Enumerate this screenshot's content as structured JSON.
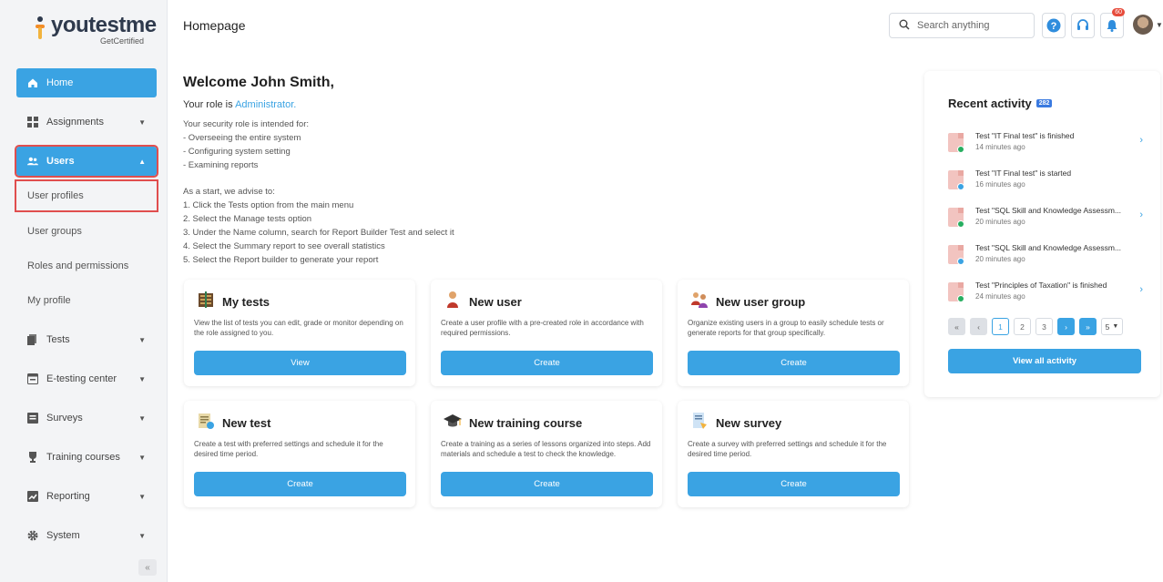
{
  "brand": {
    "name": "youtestme",
    "tagline": "GetCertified"
  },
  "header": {
    "title": "Homepage",
    "search_placeholder": "Search anything",
    "notifications_count": "60"
  },
  "sidebar": {
    "items": [
      {
        "label": "Home"
      },
      {
        "label": "Assignments"
      },
      {
        "label": "Users"
      },
      {
        "label": "User profiles"
      },
      {
        "label": "User groups"
      },
      {
        "label": "Roles and permissions"
      },
      {
        "label": "My profile"
      },
      {
        "label": "Tests"
      },
      {
        "label": "E-testing center"
      },
      {
        "label": "Surveys"
      },
      {
        "label": "Training courses"
      },
      {
        "label": "Reporting"
      },
      {
        "label": "System"
      }
    ]
  },
  "welcome": {
    "greeting": "Welcome John Smith,",
    "role_prefix": "Your role is ",
    "role": "Administrator.",
    "intro": [
      "Your security role is intended for:",
      "- Overseeing the entire system",
      "- Configuring system setting",
      "- Examining reports"
    ],
    "advise": [
      "As a start, we advise to:",
      "1. Click the Tests option from the main menu",
      "2. Select the Manage tests option",
      "3. Under the Name column, search for Report Builder Test and select it",
      "4. Select the Summary report to see overall statistics",
      "5. Select the Report builder to generate your report"
    ]
  },
  "cards": [
    {
      "title": "My tests",
      "desc": "View the list of tests you can edit, grade or monitor depending on the role assigned to you.",
      "button": "View"
    },
    {
      "title": "New user",
      "desc": "Create a user profile with a pre-created role in accordance with required permissions.",
      "button": "Create"
    },
    {
      "title": "New user group",
      "desc": "Organize existing users in a group to easily schedule tests or generate reports for that group specifically.",
      "button": "Create"
    },
    {
      "title": "New test",
      "desc": "Create a test with preferred settings and schedule it for the desired time period.",
      "button": "Create"
    },
    {
      "title": "New training course",
      "desc": "Create a training as a series of lessons organized into steps. Add materials and schedule a test to check the knowledge.",
      "button": "Create"
    },
    {
      "title": "New survey",
      "desc": "Create a survey with preferred settings and schedule it for the desired time period.",
      "button": "Create"
    }
  ],
  "activity": {
    "title": "Recent activity",
    "count": "282",
    "items": [
      {
        "text": "Test \"IT Final test\" is finished",
        "time": "14 minutes ago"
      },
      {
        "text": "Test \"IT Final test\" is started",
        "time": "16 minutes ago"
      },
      {
        "text": "Test \"SQL Skill and Knowledge Assessm...",
        "time": "20 minutes ago"
      },
      {
        "text": "Test \"SQL Skill and Knowledge Assessm...",
        "time": "20 minutes ago"
      },
      {
        "text": "Test \"Principles of Taxation\" is finished",
        "time": "24 minutes ago"
      }
    ],
    "pager": {
      "first": "«",
      "prev": "‹",
      "pages": [
        "1",
        "2",
        "3"
      ],
      "next": "›",
      "last": "»",
      "page_size": "5"
    },
    "view_all": "View all activity"
  },
  "colors": {
    "accent": "#3aa3e3",
    "highlight": "#e04e4e",
    "badge": "#e74c3c"
  }
}
